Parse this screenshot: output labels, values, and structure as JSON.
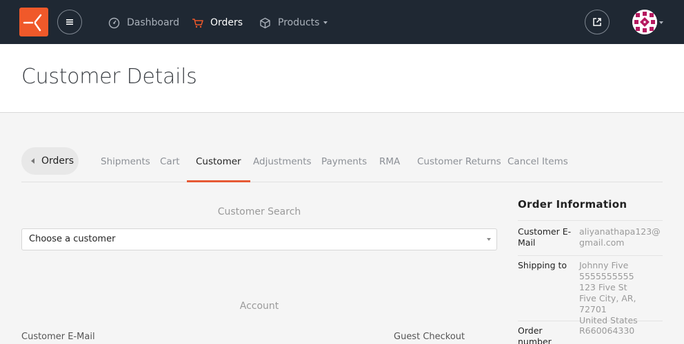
{
  "nav": {
    "items": [
      {
        "label": "Dashboard",
        "icon": "dashboard-icon"
      },
      {
        "label": "Orders",
        "icon": "cart-icon"
      },
      {
        "label": "Products",
        "icon": "box-icon"
      }
    ]
  },
  "colors": {
    "topbar": "#1f2833",
    "brand": "#f0592a",
    "active_tab_underline": "#e65a35"
  },
  "page": {
    "title": "Customer Details"
  },
  "tabs": {
    "back_label": "Orders",
    "items": [
      "Shipments",
      "Cart",
      "Customer",
      "Adjustments",
      "Payments",
      "RMA",
      "Customer Returns",
      "Cancel Items"
    ],
    "active": "Customer"
  },
  "customer_search": {
    "heading": "Customer Search",
    "select_value": "Choose a customer"
  },
  "account": {
    "heading": "Account",
    "email_label": "Customer E-Mail",
    "guest_label": "Guest Checkout"
  },
  "order_info": {
    "title": "Order Information",
    "rows": [
      {
        "key": "Customer E-Mail",
        "value": "aliyanathapa123@gmail.com"
      },
      {
        "key": "Shipping to",
        "value": "Johnny Five\n5555555555\n123 Five St\nFive City, AR, 72701\nUnited States"
      },
      {
        "key": "Order number",
        "value": "R660064330"
      }
    ]
  }
}
